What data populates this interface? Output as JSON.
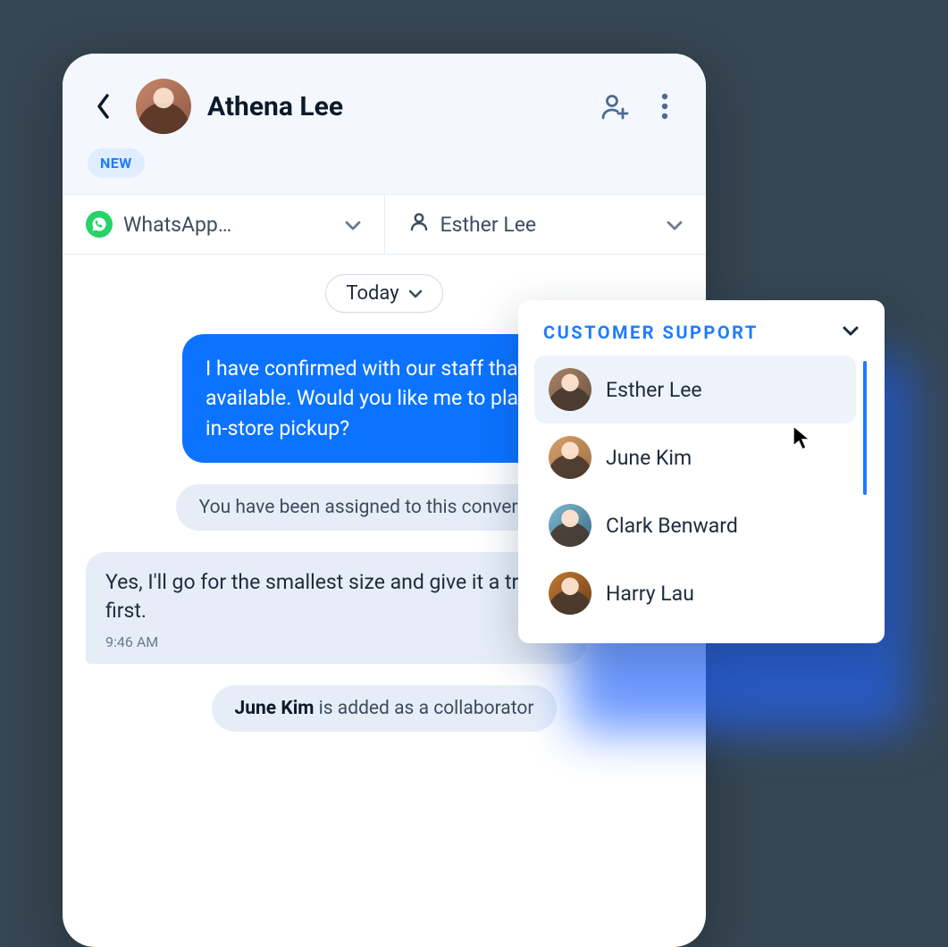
{
  "header": {
    "contact_name": "Athena Lee",
    "badge": "NEW"
  },
  "selectors": {
    "channel_label": "WhatsApp…",
    "assignee_label": "Esther Lee"
  },
  "conversation": {
    "date_label": "Today",
    "message_out": "I have confirmed with our staff that your item is available. Would you like me to place an order for in-store pickup?",
    "system_assigned": "You have been assigned to this conversation",
    "message_in": "Yes, I'll go for the smallest size and give it a try first.",
    "message_in_time": "9:46 AM",
    "collab_name": "June Kim",
    "collab_suffix": " is added as a collaborator"
  },
  "popover": {
    "title": "CUSTOMER SUPPORT",
    "agents": [
      {
        "name": "Esther Lee",
        "selected": true
      },
      {
        "name": "June Kim",
        "selected": false
      },
      {
        "name": "Clark Benward",
        "selected": false
      },
      {
        "name": "Harry Lau",
        "selected": false
      }
    ]
  }
}
